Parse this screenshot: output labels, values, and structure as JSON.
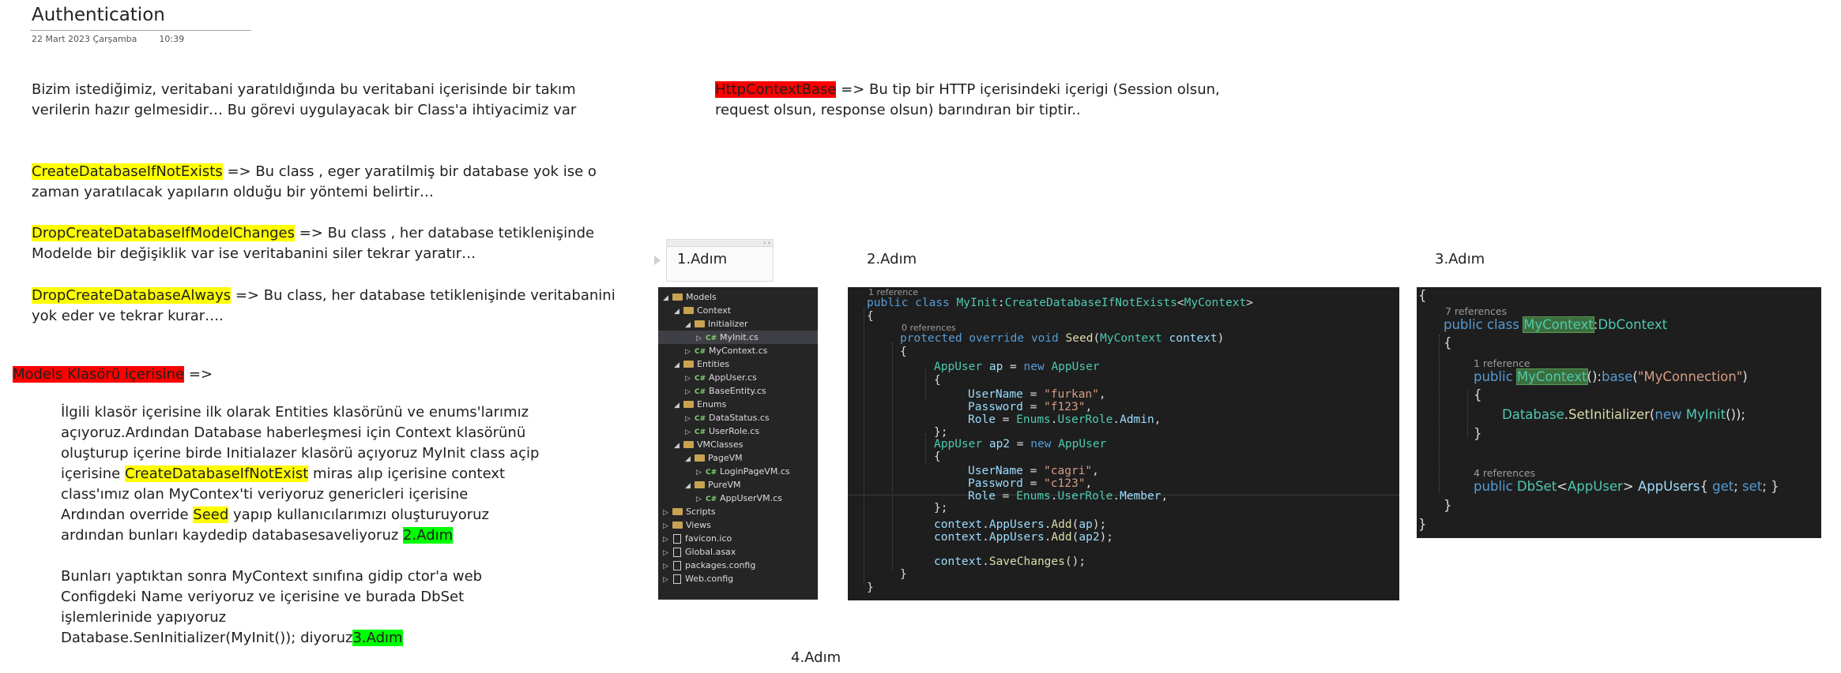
{
  "page": {
    "title": "Authentication",
    "date": "22 Mart 2023 Çarşamba",
    "time": "10:39"
  },
  "intro": {
    "line1": "Bizim istediğimiz, veritabani yaratıldığında bu veritabani içerisinde bir takım",
    "line2": "verilerin hazır gelmesidir… Bu görevi uygulayacak bir Class'a ihtiyacimiz var"
  },
  "defs": {
    "create_term": "CreateDatabaseIfNotExists",
    "create_line1": " => Bu class , eger yaratilmiş bir database yok ise o",
    "create_line2": "zaman yaratılacak yapıların olduğu bir yöntemi belirtir…",
    "drop_model_term": "DropCreateDatabaseIfModelChanges",
    "drop_model_line1": " => Bu class , her database tetiklenişinde",
    "drop_model_line2": "Modelde bir değişiklik var ise veritabanini siler tekrar yaratır…",
    "drop_always_term": "DropCreateDatabaseAlways",
    "drop_always_line1": " => Bu class, her database tetiklenişinde veritabanini",
    "drop_always_line2": "yok eder ve tekrar kurar…."
  },
  "httpctx": {
    "term": "HttpContextBase",
    "line1": " => Bu tip bir HTTP içerisindeki içerigi (Session olsun,",
    "line2": "request olsun, response olsun) barındıran bir tiptir.."
  },
  "models": {
    "heading": "Models Klasörü içerisine",
    "heading_arrow": " =>",
    "l1": "İlgili klasör içerisine ilk olarak Entities klasörünü ve enums'larımız",
    "l2": "açıyoruz.Ardından Database haberleşmesi için Context klasörünü",
    "l3": "oluşturup içerine birde Initialazer klasörü açıyoruz MyInit class açip",
    "l4_pre": "içerisine ",
    "l4_term": "CreateDatabaseIfNotExist",
    "l4_post": " miras alıp içerisine context",
    "l5": "class'ımız olan MyContex'ti veriyoruz genericleri içerisine",
    "l6_pre": "Ardından override ",
    "l6_term": "Seed",
    "l6_post": " yapıp kullanıcılarımızı oluşturuyoruz",
    "l7_pre": "ardından bunları kaydedip databasesaveliyoruz ",
    "l7_step": "2.Adım",
    "p2_l1": "Bunları yaptıktan sonra MyContext sınıfına gidip ctor'a web",
    "p2_l2": "Configdeki Name veriyoruz ve içerisine  ve burada DbSet",
    "p2_l3": "işlemlerinide yapıyoruz",
    "p2_l4_pre": "Database.SenInitializer(MyInit()); diyoruz",
    "p2_l4_step": "3.Adım"
  },
  "steps": {
    "s1": "1.Adım",
    "s2": "2.Adım",
    "s3": "3.Adım",
    "s4": "4.Adım"
  },
  "tree": [
    {
      "label": "Models",
      "kind": "folder",
      "expanded": true,
      "depth": 0
    },
    {
      "label": "Context",
      "kind": "folder",
      "expanded": true,
      "depth": 1
    },
    {
      "label": "Initializer",
      "kind": "folder",
      "expanded": true,
      "depth": 2
    },
    {
      "label": "MyInit.cs",
      "kind": "cs",
      "expanded": false,
      "depth": 3,
      "selected": true
    },
    {
      "label": "MyContext.cs",
      "kind": "cs",
      "expanded": false,
      "depth": 2
    },
    {
      "label": "Entities",
      "kind": "folder",
      "expanded": true,
      "depth": 1
    },
    {
      "label": "AppUser.cs",
      "kind": "cs",
      "expanded": false,
      "depth": 2
    },
    {
      "label": "BaseEntity.cs",
      "kind": "cs",
      "expanded": false,
      "depth": 2
    },
    {
      "label": "Enums",
      "kind": "folder",
      "expanded": true,
      "depth": 1
    },
    {
      "label": "DataStatus.cs",
      "kind": "cs",
      "expanded": false,
      "depth": 2
    },
    {
      "label": "UserRole.cs",
      "kind": "cs",
      "expanded": false,
      "depth": 2
    },
    {
      "label": "VMClasses",
      "kind": "folder",
      "expanded": true,
      "depth": 1
    },
    {
      "label": "PageVM",
      "kind": "folder",
      "expanded": true,
      "depth": 2
    },
    {
      "label": "LoginPageVM.cs",
      "kind": "cs",
      "expanded": false,
      "depth": 3
    },
    {
      "label": "PureVM",
      "kind": "folder",
      "expanded": true,
      "depth": 2
    },
    {
      "label": "AppUserVM.cs",
      "kind": "cs",
      "expanded": false,
      "depth": 3
    },
    {
      "label": "Scripts",
      "kind": "folder",
      "expanded": false,
      "depth": 0
    },
    {
      "label": "Views",
      "kind": "folder",
      "expanded": false,
      "depth": 0
    },
    {
      "label": "favicon.ico",
      "kind": "file",
      "expanded": false,
      "depth": 0
    },
    {
      "label": "Global.asax",
      "kind": "file",
      "expanded": false,
      "depth": 0
    },
    {
      "label": "packages.config",
      "kind": "file",
      "expanded": false,
      "depth": 0
    },
    {
      "label": "Web.config",
      "kind": "file",
      "expanded": false,
      "depth": 0
    }
  ],
  "code_init": {
    "ref_1": "1 reference",
    "ref_0": "0 references",
    "user1_name": "\"furkan\"",
    "user1_pass": "\"f123\"",
    "user2_name": "\"cagri\"",
    "user2_pass": "\"c123\""
  },
  "code_ctx": {
    "ref_7": "7 references",
    "ref_1": "1 reference",
    "ref_4": "4 references",
    "conn": "\"MyConnection\""
  }
}
